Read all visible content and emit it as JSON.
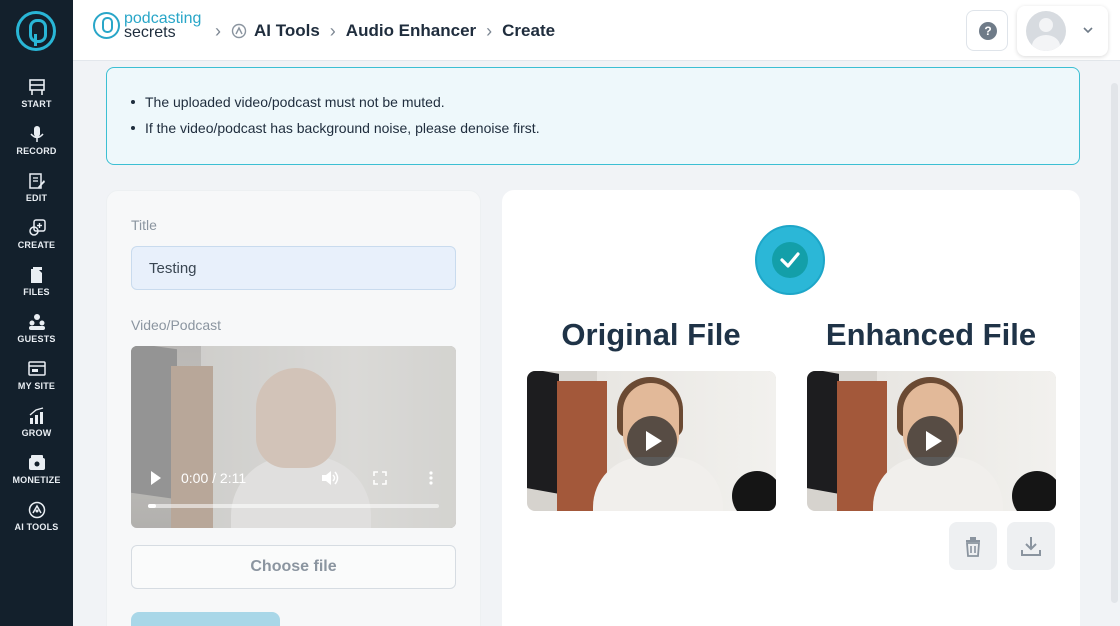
{
  "sidebar": {
    "items": [
      {
        "label": "START",
        "icon": "start-icon"
      },
      {
        "label": "RECORD",
        "icon": "microphone-icon"
      },
      {
        "label": "EDIT",
        "icon": "edit-icon"
      },
      {
        "label": "CREATE",
        "icon": "create-icon"
      },
      {
        "label": "FILES",
        "icon": "files-icon"
      },
      {
        "label": "GUESTS",
        "icon": "guests-icon"
      },
      {
        "label": "MY SITE",
        "icon": "my-site-icon"
      },
      {
        "label": "GROW",
        "icon": "grow-icon"
      },
      {
        "label": "MONETIZE",
        "icon": "monetize-icon"
      },
      {
        "label": "AI TOOLS",
        "icon": "ai-tools-icon"
      }
    ]
  },
  "header": {
    "brand_line1": "podcasting",
    "brand_line2": "secrets",
    "breadcrumb": [
      "AI Tools",
      "Audio Enhancer",
      "Create"
    ],
    "help_symbol": "?"
  },
  "info": {
    "lines": [
      "The uploaded video/podcast must not be muted.",
      "If the video/podcast has background noise, please denoise first."
    ]
  },
  "form": {
    "title_label": "Title",
    "title_value": "Testing",
    "media_label": "Video/Podcast",
    "player_time": "0:00 / 2:11",
    "player_progress": 0,
    "choose_file_label": "Choose file"
  },
  "result": {
    "original_title": "Original File",
    "enhanced_title": "Enhanced File"
  },
  "colors": {
    "sidebar_bg": "#13202c",
    "accent": "#29b6d6",
    "info_border": "#3cbfd3"
  }
}
